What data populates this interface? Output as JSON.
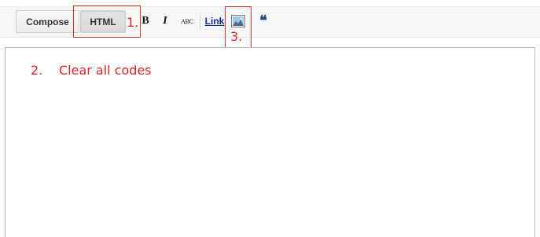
{
  "toolbar": {
    "compose_label": "Compose",
    "html_label": "HTML",
    "bold_label": "B",
    "italic_label": "I",
    "strike_label": "ABC",
    "link_label": "Link",
    "image_icon": "image-icon",
    "quote_icon": "quote-icon",
    "quote_glyph": "❝"
  },
  "annotations": {
    "step1": "1.",
    "step2_number": "2.",
    "step2_text": "Clear all codes",
    "step3": "3.",
    "color": "#d9282c"
  },
  "colors": {
    "link": "#0b2c9a",
    "quote": "#2b4a77",
    "toolbar_bg": "#f6f6f6"
  }
}
